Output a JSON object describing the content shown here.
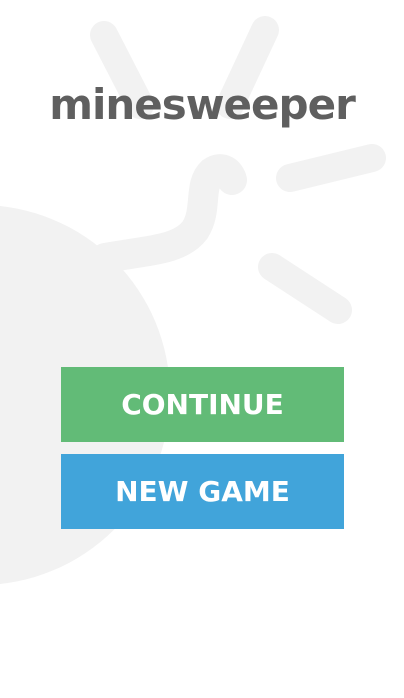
{
  "app": {
    "title": "minesweeper"
  },
  "menu": {
    "continue_label": "CONTINUE",
    "new_game_label": "NEW GAME"
  },
  "background": {
    "art_icon": "bomb-icon"
  },
  "colors": {
    "title": "#5f5f5f",
    "continue_button": "#62bb77",
    "new_game_button": "#41a4da",
    "background_art": "#f2f2f2",
    "page_background": "#ffffff"
  }
}
